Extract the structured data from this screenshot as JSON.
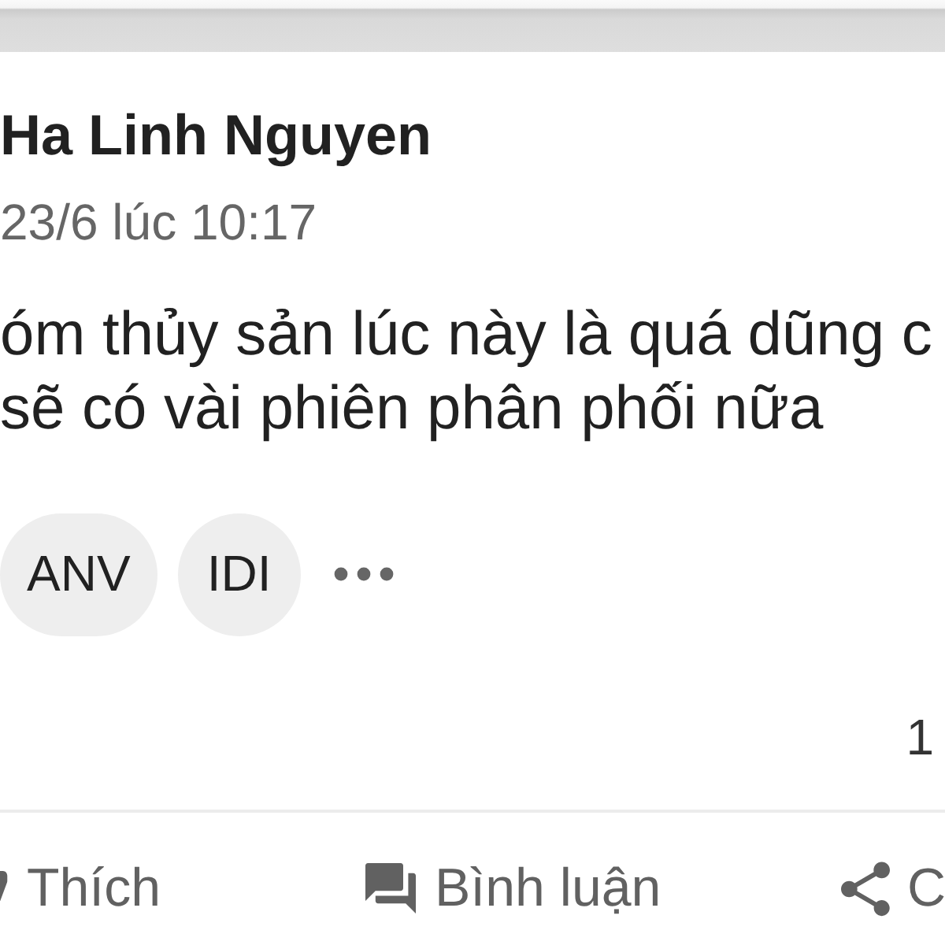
{
  "post": {
    "author": "Ha Linh Nguyen",
    "timestamp": "23/6 lúc 10:17",
    "body_lines": [
      "óm thủy sản lúc này là quá dũng c",
      "sẽ có vài phiên phân phối nữa"
    ],
    "tags": [
      {
        "label": "ANV"
      },
      {
        "label": "IDI"
      }
    ],
    "count": "1"
  },
  "actions": [
    {
      "kind": "like",
      "label": "Thích"
    },
    {
      "kind": "comment",
      "label": "Bình luận"
    },
    {
      "kind": "share",
      "label": "C"
    }
  ]
}
